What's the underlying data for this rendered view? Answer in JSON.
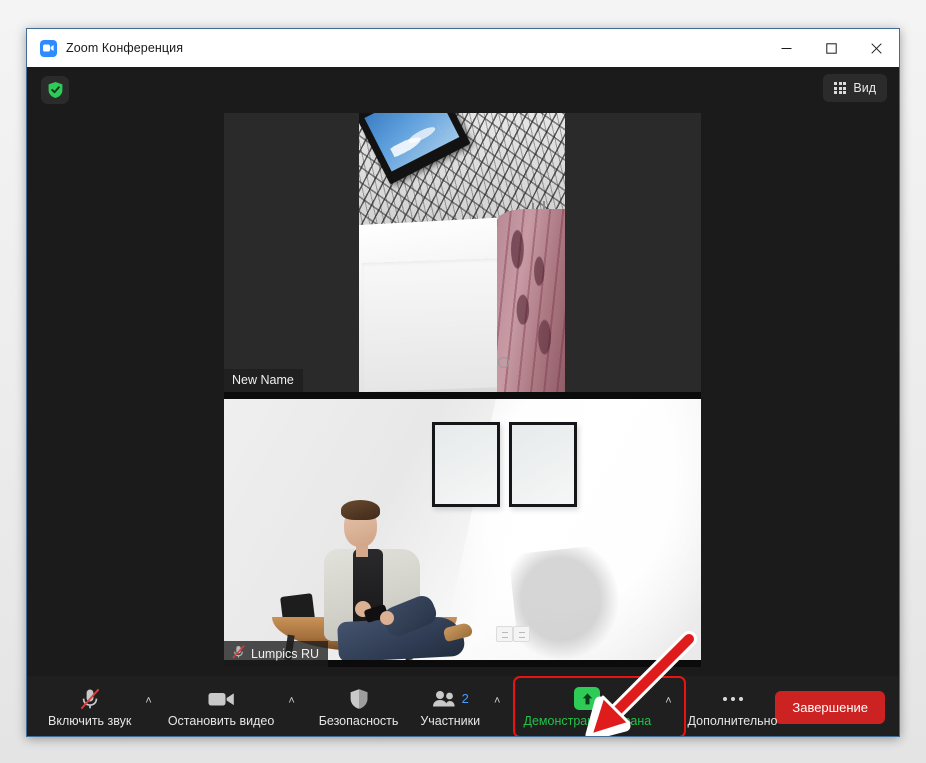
{
  "window": {
    "title": "Zoom Конференция",
    "app_icon": "zoom-camera-icon",
    "controls": {
      "minimize": "−",
      "maximize": "□",
      "close": "✕"
    }
  },
  "topbar": {
    "encryption_icon": "green-shield-check-icon",
    "view_button": {
      "label": "Вид",
      "icon": "grid-view-icon"
    }
  },
  "video_tiles": [
    {
      "name": "New Name",
      "muted": false,
      "scene": "portrait-video-ceiling-curtain"
    },
    {
      "name": "Lumpics RU",
      "muted": true,
      "mic_icon": "mic-muted-icon",
      "scene": "man-seated-on-chair-with-phone"
    }
  ],
  "toolbar": {
    "items": [
      {
        "id": "audio",
        "label": "Включить звук",
        "icon": "mic-muted-icon",
        "has_chevron": true
      },
      {
        "id": "video",
        "label": "Остановить видео",
        "icon": "camera-icon",
        "has_chevron": true
      },
      {
        "id": "security",
        "label": "Безопасность",
        "icon": "shield-icon",
        "has_chevron": false
      },
      {
        "id": "participants",
        "label": "Участники",
        "icon": "people-icon",
        "count": "2",
        "has_chevron": true
      },
      {
        "id": "share",
        "label": "Демонстрация экрана",
        "icon": "share-screen-up-arrow-icon",
        "has_chevron": true,
        "highlighted": true
      },
      {
        "id": "more",
        "label": "Дополнительно",
        "icon": "more-dots-icon",
        "has_chevron": false
      }
    ],
    "end_button": "Завершение"
  },
  "annotation": {
    "arrow": "red-arrow-pointing-to-share-screen",
    "highlight_color": "#ee1111"
  },
  "colors": {
    "accent_green": "#2ecc57",
    "share_text_green": "#25c04a",
    "end_red": "#cc2222",
    "badge_blue": "#4a9bf5",
    "annotation_red": "#ee1111",
    "window_bg": "#1b1b1b",
    "toolbar_bg": "#1f1f1f"
  }
}
